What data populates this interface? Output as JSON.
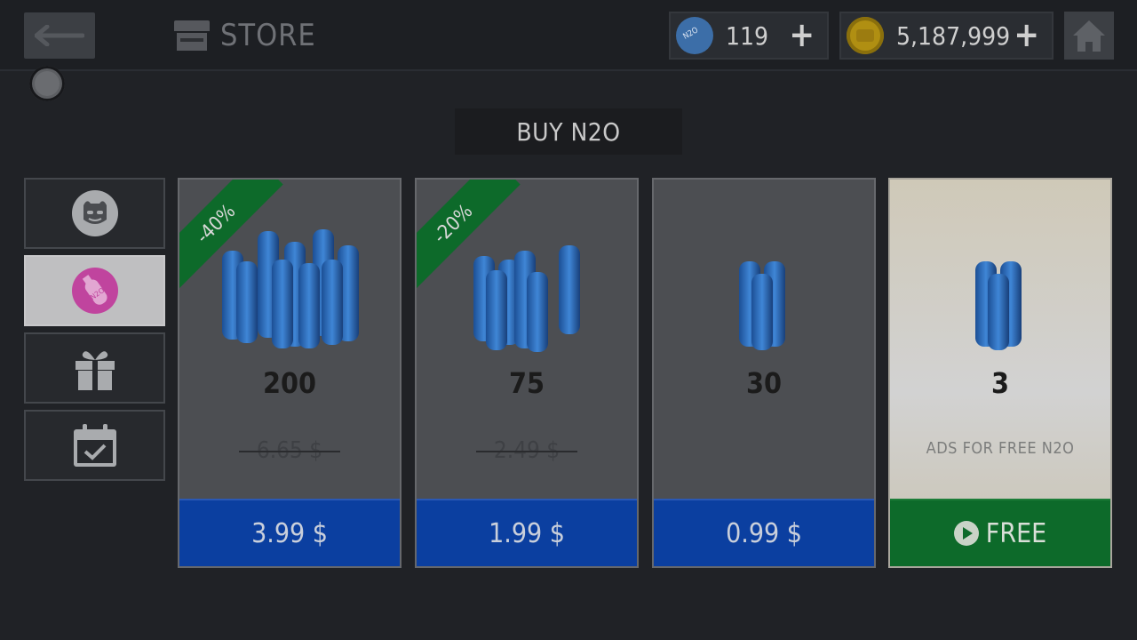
{
  "header": {
    "back_icon": "arrow-left-icon",
    "title": "STORE",
    "title_icon": "store-icon",
    "currencies": [
      {
        "name": "n2o",
        "icon": "n2o-bottle-icon",
        "value": "119",
        "plus": "+"
      },
      {
        "name": "gold",
        "icon": "gold-coin-icon",
        "value": "5,187,999",
        "plus": "+"
      }
    ],
    "home_icon": "home-icon"
  },
  "heading": "BUY N2O",
  "sidebar": {
    "tabs": [
      {
        "name": "characters",
        "icon": "devil-mask-icon",
        "active": false
      },
      {
        "name": "n2o",
        "icon": "n2o-bottle-icon",
        "active": true
      },
      {
        "name": "gifts",
        "icon": "gift-icon",
        "active": false
      },
      {
        "name": "daily",
        "icon": "calendar-check-icon",
        "active": false
      }
    ]
  },
  "offers": [
    {
      "amount": "200",
      "discount": "-40%",
      "old_price": "6.65 $",
      "price": "3.99 $",
      "bottles": 9
    },
    {
      "amount": "75",
      "discount": "-20%",
      "old_price": "2.49 $",
      "price": "1.99 $",
      "bottles": 6
    },
    {
      "amount": "30",
      "discount": "",
      "old_price": "",
      "price": "0.99 $",
      "bottles": 3
    },
    {
      "amount": "3",
      "discount": "",
      "old_price": "",
      "note": "ADS FOR FREE N2O",
      "price": "FREE",
      "bottles": 3,
      "free": true
    }
  ],
  "colors": {
    "buy_blue": "#0b3fa0",
    "free_green": "#0d6a2a",
    "bottle_blue": "#2f6fbf",
    "active_tab_icon": "#c0449e"
  }
}
